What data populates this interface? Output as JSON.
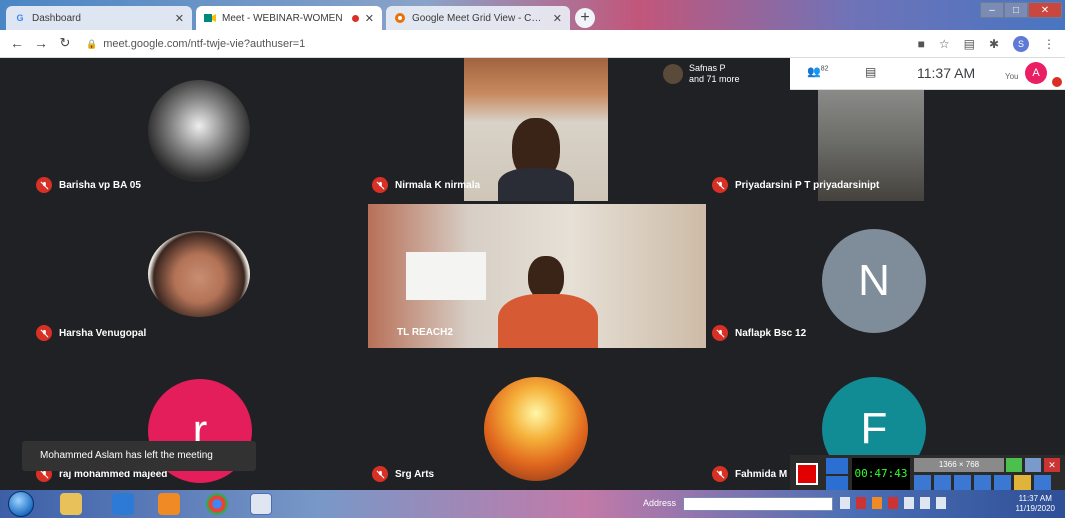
{
  "browser": {
    "tabs": [
      {
        "label": "Dashboard",
        "favicon": "G",
        "active": false
      },
      {
        "label": "Meet - WEBINAR-WOMEN",
        "favicon": "meet-icon",
        "active": true
      },
      {
        "label": "Google Meet Grid View - Chrom",
        "favicon": "extension-icon",
        "active": false
      }
    ],
    "url": "meet.google.com/ntf-twje-vie?authuser=1",
    "profile_initial": "S"
  },
  "meet": {
    "participants_summary": {
      "name": "Safnas P",
      "more": "and 71 more"
    },
    "participant_count": "82",
    "time": "11:37 AM",
    "self_label": "You",
    "self_initial": "A",
    "toast": "Mohammed Aslam has left the meeting",
    "tiles": [
      {
        "name": "Barisha vp BA 05"
      },
      {
        "name": "Nirmala K nirmala"
      },
      {
        "name": "Priyadarsini P T priyadarsinipt"
      },
      {
        "name": "Harsha Venugopal"
      },
      {
        "name": "TL REACH2"
      },
      {
        "name": "Naflapk Bsc 12",
        "initial": "N"
      },
      {
        "name": "raj mohammed majeed",
        "initial": "r"
      },
      {
        "name": "Srg Arts"
      },
      {
        "name": "Fahmida M",
        "initial": "F"
      }
    ]
  },
  "recorder": {
    "timer": "00:47:43",
    "resolution": "1366 × 768"
  },
  "taskbar": {
    "address_label": "Address",
    "clock_time": "11:37 AM",
    "clock_date": "11/19/2020"
  },
  "colors": {
    "mic_off": "#d93025",
    "avatar_n": "#7f8c99",
    "avatar_r": "#e31e5a",
    "avatar_f": "#128c94"
  }
}
